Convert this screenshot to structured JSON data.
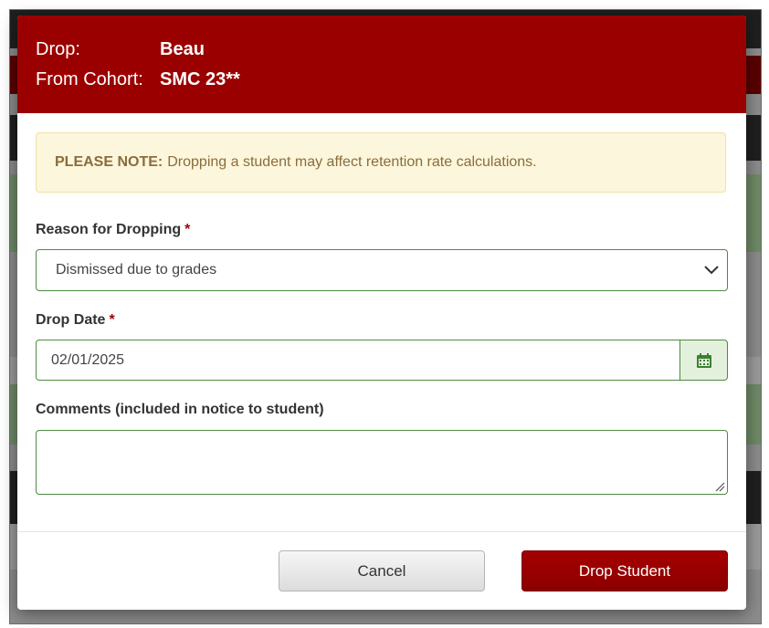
{
  "header": {
    "drop_label": "Drop:",
    "drop_value": "Beau",
    "cohort_label": "From Cohort:",
    "cohort_value": "SMC 23**"
  },
  "note": {
    "strong": "PLEASE NOTE:",
    "text": "Dropping a student may affect retention rate calculations."
  },
  "reason": {
    "label": "Reason for Dropping",
    "required_mark": "*",
    "selected": "Dismissed due to grades"
  },
  "drop_date": {
    "label": "Drop Date",
    "required_mark": "*",
    "value": "02/01/2025"
  },
  "comments": {
    "label": "Comments (included in notice to student)",
    "value": ""
  },
  "buttons": {
    "cancel": "Cancel",
    "drop": "Drop Student"
  },
  "colors": {
    "header_bg": "#9b0000",
    "note_bg": "#fcf6dc",
    "note_text": "#8a6d3b",
    "field_border": "#4d8a3f",
    "calendar_bg": "#e3f1dc",
    "required": "#a00000"
  },
  "icons": {
    "select_arrow": "chevron-down-icon",
    "date_picker": "calendar-icon",
    "resize_handle": "resize-grip-icon"
  }
}
